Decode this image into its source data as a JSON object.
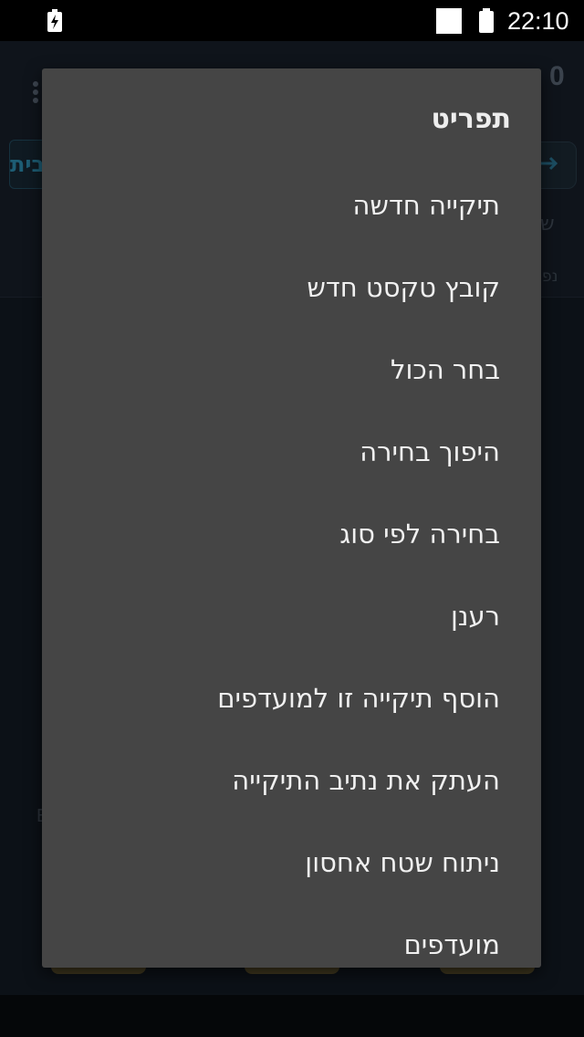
{
  "status_bar": {
    "time": "22:10",
    "icons": [
      "charging-bolt-icon",
      "notification-square-icon",
      "battery-icon"
    ]
  },
  "background": {
    "count": "0",
    "left_button_fragment": "בית",
    "side_fragment_1": "ש",
    "side_fragment_2": "נפ",
    "left_letter": "E"
  },
  "menu": {
    "title": "תפריט",
    "items": [
      {
        "label": "תיקייה חדשה"
      },
      {
        "label": "קובץ טקסט חדש"
      },
      {
        "label": "בחר הכול"
      },
      {
        "label": "היפוך בחירה"
      },
      {
        "label": "בחירה לפי סוג"
      },
      {
        "label": "רענן"
      },
      {
        "label": "הוסף תיקייה זו למועדפים"
      },
      {
        "label": "העתק את נתיב התיקייה"
      },
      {
        "label": "ניתוח שטח אחסון"
      },
      {
        "label": "מועדפים"
      }
    ]
  },
  "colors": {
    "menu_background": "#454545",
    "menu_text": "#f0f0f0",
    "status_bar": "#000000"
  }
}
